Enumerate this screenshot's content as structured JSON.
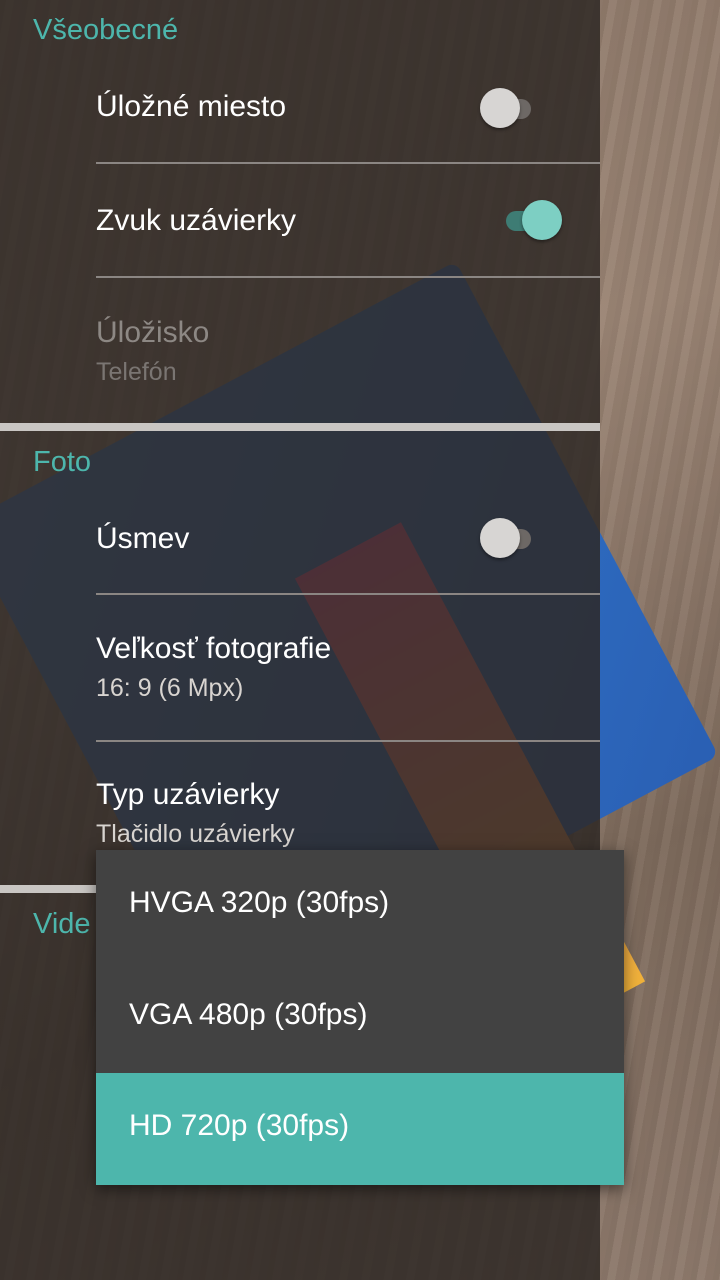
{
  "sections": {
    "general": {
      "title": "Všeobecné",
      "items": {
        "location": {
          "label": "Úložné miesto",
          "toggle": "off"
        },
        "shutter_sound": {
          "label": "Zvuk uzávierky",
          "toggle": "on"
        },
        "storage": {
          "label": "Úložisko",
          "value": "Telefón",
          "enabled": false
        }
      }
    },
    "photo": {
      "title": "Foto",
      "items": {
        "smile": {
          "label": "Úsmev",
          "toggle": "off"
        },
        "photo_size": {
          "label": "Veľkosť fotografie",
          "value": "16: 9 (6 Mpx)"
        },
        "shutter_type": {
          "label": "Typ uzávierky",
          "value": "Tlačidlo uzávierky"
        }
      }
    },
    "video": {
      "title": "Vide"
    }
  },
  "dropdown": {
    "options": [
      {
        "label": "HVGA 320p (30fps)",
        "selected": false
      },
      {
        "label": "VGA 480p (30fps)",
        "selected": false
      },
      {
        "label": "HD 720p (30fps)",
        "selected": true
      }
    ]
  },
  "colors": {
    "accent": "#4db6ac",
    "drawer_bg": "#2d2724",
    "popup_bg": "#424242"
  }
}
